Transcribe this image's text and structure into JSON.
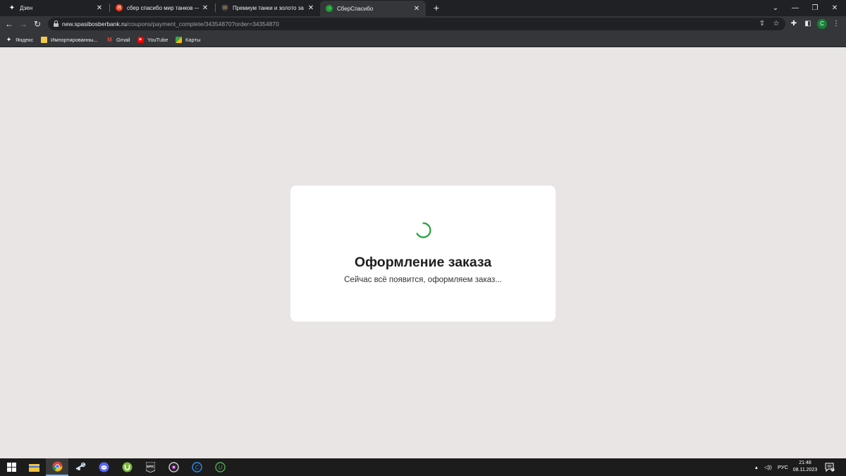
{
  "tabs": [
    {
      "title": "Дзен",
      "favicon": "dzen-icon"
    },
    {
      "title": "сбер спасибо мир танков — Яндекс",
      "favicon": "yandex-icon"
    },
    {
      "title": "Премиум танки и золото за бонусы",
      "favicon": "tanks-icon"
    },
    {
      "title": "СберСпасибо",
      "favicon": "sberspasibo-icon",
      "active": true
    }
  ],
  "address_bar": {
    "host": "new.spasibosberbank.ru",
    "path": "/coupons/payment_complete/34354870?order=34354870"
  },
  "profile_initial": "C",
  "bookmarks": [
    {
      "label": "Яндекс",
      "icon": "yandex-star-icon"
    },
    {
      "label": "Импортированны...",
      "icon": "folder-icon"
    },
    {
      "label": "Gmail",
      "icon": "gmail-icon"
    },
    {
      "label": "YouTube",
      "icon": "youtube-icon"
    },
    {
      "label": "Карты",
      "icon": "maps-icon"
    }
  ],
  "dialog": {
    "title": "Оформление заказа",
    "subtitle": "Сейчас всё появится, оформляем заказ..."
  },
  "taskbar": {
    "apps": [
      "start-icon",
      "file-explorer-icon",
      "chrome-icon",
      "steam-icon",
      "discord-icon",
      "utorrent-icon",
      "epic-games-icon",
      "wot-game-center-icon",
      "ccleaner-icon",
      "upwork-icon"
    ],
    "language": "РУС",
    "time": "21:48",
    "date": "08.11.2023",
    "notifications": "3"
  },
  "colors": {
    "page_bg": "#e9e5e4",
    "spinner": "#21a038",
    "tab_strip": "#202124",
    "toolbar": "#35363a"
  }
}
